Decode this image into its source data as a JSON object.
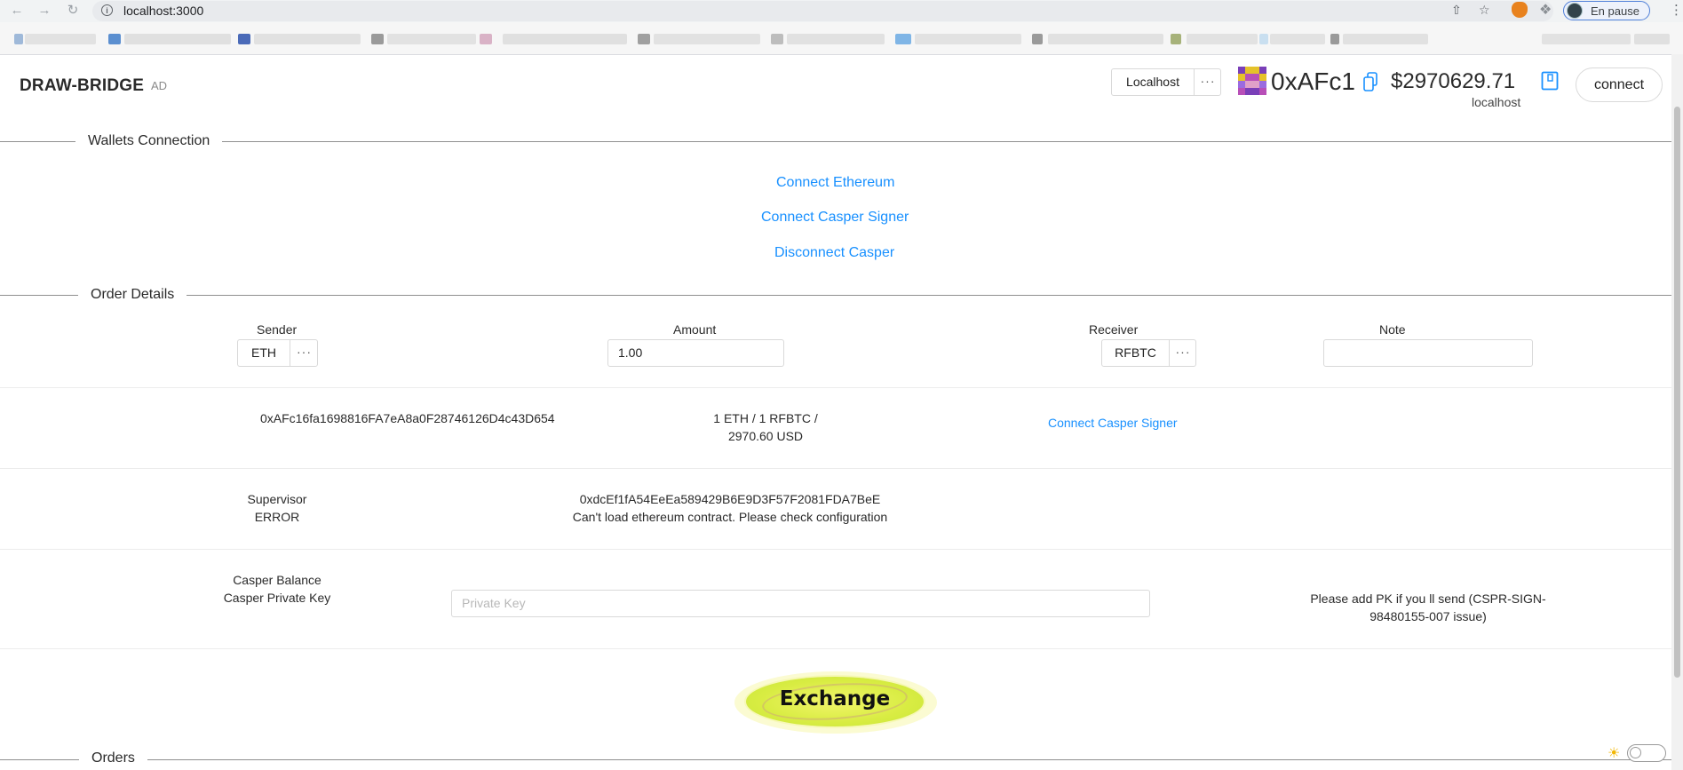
{
  "browser": {
    "url": "localhost:3000",
    "profile_status": "En pause"
  },
  "header": {
    "brand": "DRAW-BRIDGE",
    "brand_sub": "AD",
    "network_select": "Localhost",
    "dots": "···",
    "address_short": "0xAFc1",
    "balance": "$2970629.71",
    "network_name": "localhost",
    "connect_label": "connect"
  },
  "wallets": {
    "title": "Wallets Connection",
    "connect_ethereum": "Connect Ethereum",
    "connect_casper_signer": "Connect Casper Signer",
    "disconnect_casper": "Disconnect Casper"
  },
  "order": {
    "title": "Order Details",
    "sender_label": "Sender",
    "sender_value": "ETH",
    "amount_label": "Amount",
    "amount_value": "1.00",
    "receiver_label": "Receiver",
    "receiver_value": "RFBTC",
    "note_label": "Note",
    "note_value": "",
    "eth_address": "0xAFc16fa1698816FA7eA8a0F28746126D4c43D654",
    "rate_line1": "1 ETH / 1 RFBTC /",
    "rate_line2": "2970.60 USD",
    "connect_casper_signer": "Connect Casper Signer",
    "supervisor_label": "Supervisor",
    "supervisor_status": "ERROR",
    "contract_address": "0xdcEf1fA54EeEa589429B6E9D3F57F2081FDA7BeE",
    "contract_error": "Can't load ethereum contract. Please check configuration",
    "casper_balance_label": "Casper Balance",
    "casper_pk_label": "Casper Private Key",
    "pk_placeholder": "Private Key",
    "pk_note_line1": "Please add PK if you ll send (CSPR-SIGN-",
    "pk_note_line2": "98480155-007 issue)",
    "exchange_label": "Exchange"
  },
  "orders": {
    "title": "Orders"
  },
  "colors": {
    "link": "#1890ff",
    "exchange_button": "#d8ec42",
    "divider": "#8f8f8f"
  }
}
